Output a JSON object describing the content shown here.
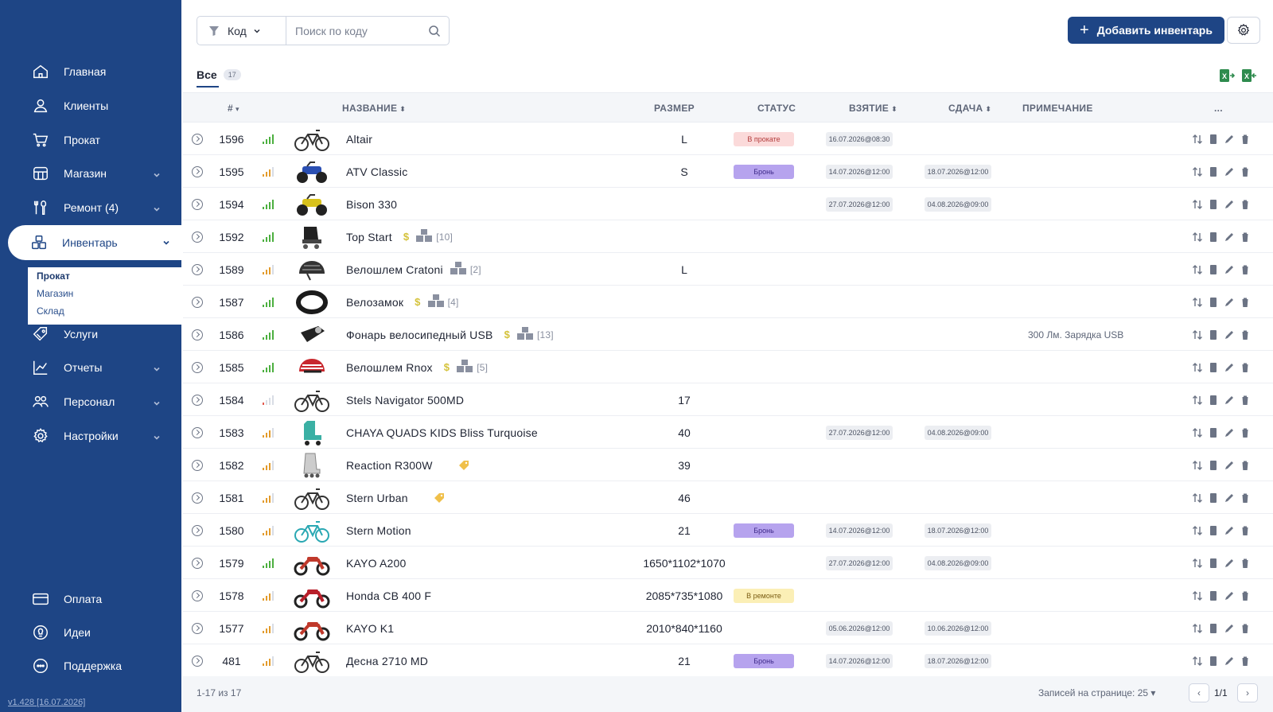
{
  "sidebar": {
    "items": [
      {
        "label": "Главная",
        "icon": "home-icon",
        "chevron": false
      },
      {
        "label": "Клиенты",
        "icon": "user-icon",
        "chevron": false
      },
      {
        "label": "Прокат",
        "icon": "cart-icon",
        "chevron": false
      },
      {
        "label": "Магазин",
        "icon": "store-icon",
        "chevron": true
      },
      {
        "label": "Ремонт (4)",
        "icon": "tools-icon",
        "chevron": true
      },
      {
        "label": "Инвентарь",
        "icon": "boxes-icon",
        "chevron": true,
        "active": true
      },
      {
        "label": "Услуги",
        "icon": "tag-icon",
        "chevron": false
      },
      {
        "label": "Отчеты",
        "icon": "chart-icon",
        "chevron": true
      },
      {
        "label": "Персонал",
        "icon": "people-icon",
        "chevron": true
      },
      {
        "label": "Настройки",
        "icon": "gear-icon",
        "chevron": true
      }
    ],
    "sub_items": [
      "Прокат",
      "Магазин",
      "Склад"
    ],
    "bottom_items": [
      {
        "label": "Оплата",
        "icon": "card-icon"
      },
      {
        "label": "Идеи",
        "icon": "bulb-icon"
      },
      {
        "label": "Поддержка",
        "icon": "chat-icon"
      }
    ],
    "version": "v1.428 [16.07.2026]"
  },
  "toolbar": {
    "filter_label": "Код",
    "search_placeholder": "Поиск по коду",
    "add_label": "Добавить инвентарь"
  },
  "tabs": {
    "all_label": "Все",
    "all_count": "17"
  },
  "table": {
    "headers": {
      "id": "#",
      "name": "НАЗВАНИЕ",
      "size": "РАЗМЕР",
      "status": "СТАТУС",
      "take": "ВЗЯТИЕ",
      "return": "СДАЧА",
      "note": "ПРИМЕЧАНИЕ",
      "more": "..."
    },
    "rows": [
      {
        "id": "1596",
        "sig": "green",
        "img": "bike",
        "name": "Altair",
        "size": "L",
        "status": "В прокате",
        "status_kind": "rent",
        "take": "16.07.2026@08:30",
        "ret": "",
        "note": ""
      },
      {
        "id": "1595",
        "sig": "orange",
        "img": "atv",
        "name": "ATV Classic",
        "size": "S",
        "status": "Бронь",
        "status_kind": "book",
        "take": "14.07.2026@12:00",
        "ret": "18.07.2026@12:00",
        "note": ""
      },
      {
        "id": "1594",
        "sig": "green",
        "img": "atv-yellow",
        "name": "Bison 330",
        "size": "",
        "status": "",
        "take": "27.07.2026@12:00",
        "ret": "04.08.2026@09:00",
        "note": ""
      },
      {
        "id": "1592",
        "sig": "green",
        "img": "skate",
        "name": "Top Start",
        "dollar": "$",
        "stock": "[10]",
        "size": "",
        "status": "",
        "take": "",
        "ret": "",
        "note": ""
      },
      {
        "id": "1589",
        "sig": "orange",
        "img": "helmet",
        "name": "Велошлем Cratoni",
        "stock": "[2]",
        "size": "L",
        "status": "",
        "take": "",
        "ret": "",
        "note": ""
      },
      {
        "id": "1587",
        "sig": "green",
        "img": "lock",
        "name": "Велозамок",
        "dollar": "$",
        "stock": "[4]",
        "size": "",
        "status": "",
        "take": "",
        "ret": "",
        "note": ""
      },
      {
        "id": "1586",
        "sig": "green",
        "img": "light",
        "name": "Фонарь велосипедный USB",
        "dollar": "$",
        "stock": "[13]",
        "size": "",
        "status": "",
        "take": "",
        "ret": "",
        "note": "300 Лм. Зарядка USB"
      },
      {
        "id": "1585",
        "sig": "green",
        "img": "helmet-red",
        "name": "Велошлем Rnox",
        "dollar": "$",
        "stock": "[5]",
        "size": "",
        "status": "",
        "take": "",
        "ret": "",
        "note": ""
      },
      {
        "id": "1584",
        "sig": "red",
        "img": "bike",
        "name": "Stels Navigator 500MD",
        "size": "17",
        "status": "",
        "take": "",
        "ret": "",
        "note": ""
      },
      {
        "id": "1583",
        "sig": "orange",
        "img": "roller",
        "name": "CHAYA QUADS KIDS Bliss Turquoise",
        "size": "40",
        "status": "",
        "take": "27.07.2026@12:00",
        "ret": "04.08.2026@09:00",
        "note": ""
      },
      {
        "id": "1582",
        "sig": "orange",
        "img": "inline",
        "name": "Reaction R300W",
        "tag": true,
        "size": "39",
        "status": "",
        "take": "",
        "ret": "",
        "note": ""
      },
      {
        "id": "1581",
        "sig": "orange",
        "img": "bike",
        "name": "Stern Urban",
        "tag": true,
        "size": "46",
        "status": "",
        "take": "",
        "ret": "",
        "note": ""
      },
      {
        "id": "1580",
        "sig": "orange",
        "img": "bike-teal",
        "name": "Stern Motion",
        "size": "21",
        "status": "Бронь",
        "status_kind": "book",
        "take": "14.07.2026@12:00",
        "ret": "18.07.2026@12:00",
        "note": ""
      },
      {
        "id": "1579",
        "sig": "green",
        "img": "moto",
        "name": "KAYO A200",
        "size": "1650*1102*1070",
        "status": "",
        "take": "27.07.2026@12:00",
        "ret": "04.08.2026@09:00",
        "note": ""
      },
      {
        "id": "1578",
        "sig": "orange",
        "img": "moto-red",
        "name": "Honda CB 400 F",
        "size": "2085*735*1080",
        "status": "В ремонте",
        "status_kind": "repair",
        "take": "",
        "ret": "",
        "note": ""
      },
      {
        "id": "1577",
        "sig": "orange",
        "img": "moto",
        "name": "KAYO K1",
        "size": "2010*840*1160",
        "status": "",
        "take": "05.06.2026@12:00",
        "ret": "10.06.2026@12:00",
        "note": ""
      },
      {
        "id": "481",
        "sig": "orange",
        "img": "bike",
        "name": "Десна 2710 MD",
        "size": "21",
        "status": "Бронь",
        "status_kind": "book",
        "take": "14.07.2026@12:00",
        "ret": "18.07.2026@12:00",
        "note": ""
      }
    ]
  },
  "footer": {
    "range": "1-17 из 17",
    "per_page": "Записей на странице: 25",
    "page": "1/1"
  },
  "colors": {
    "sidebar": "#1e4585",
    "accent": "#1e4585",
    "signal_green": "#4caf3f",
    "signal_orange": "#e39b2b",
    "signal_red": "#e35a4f"
  }
}
